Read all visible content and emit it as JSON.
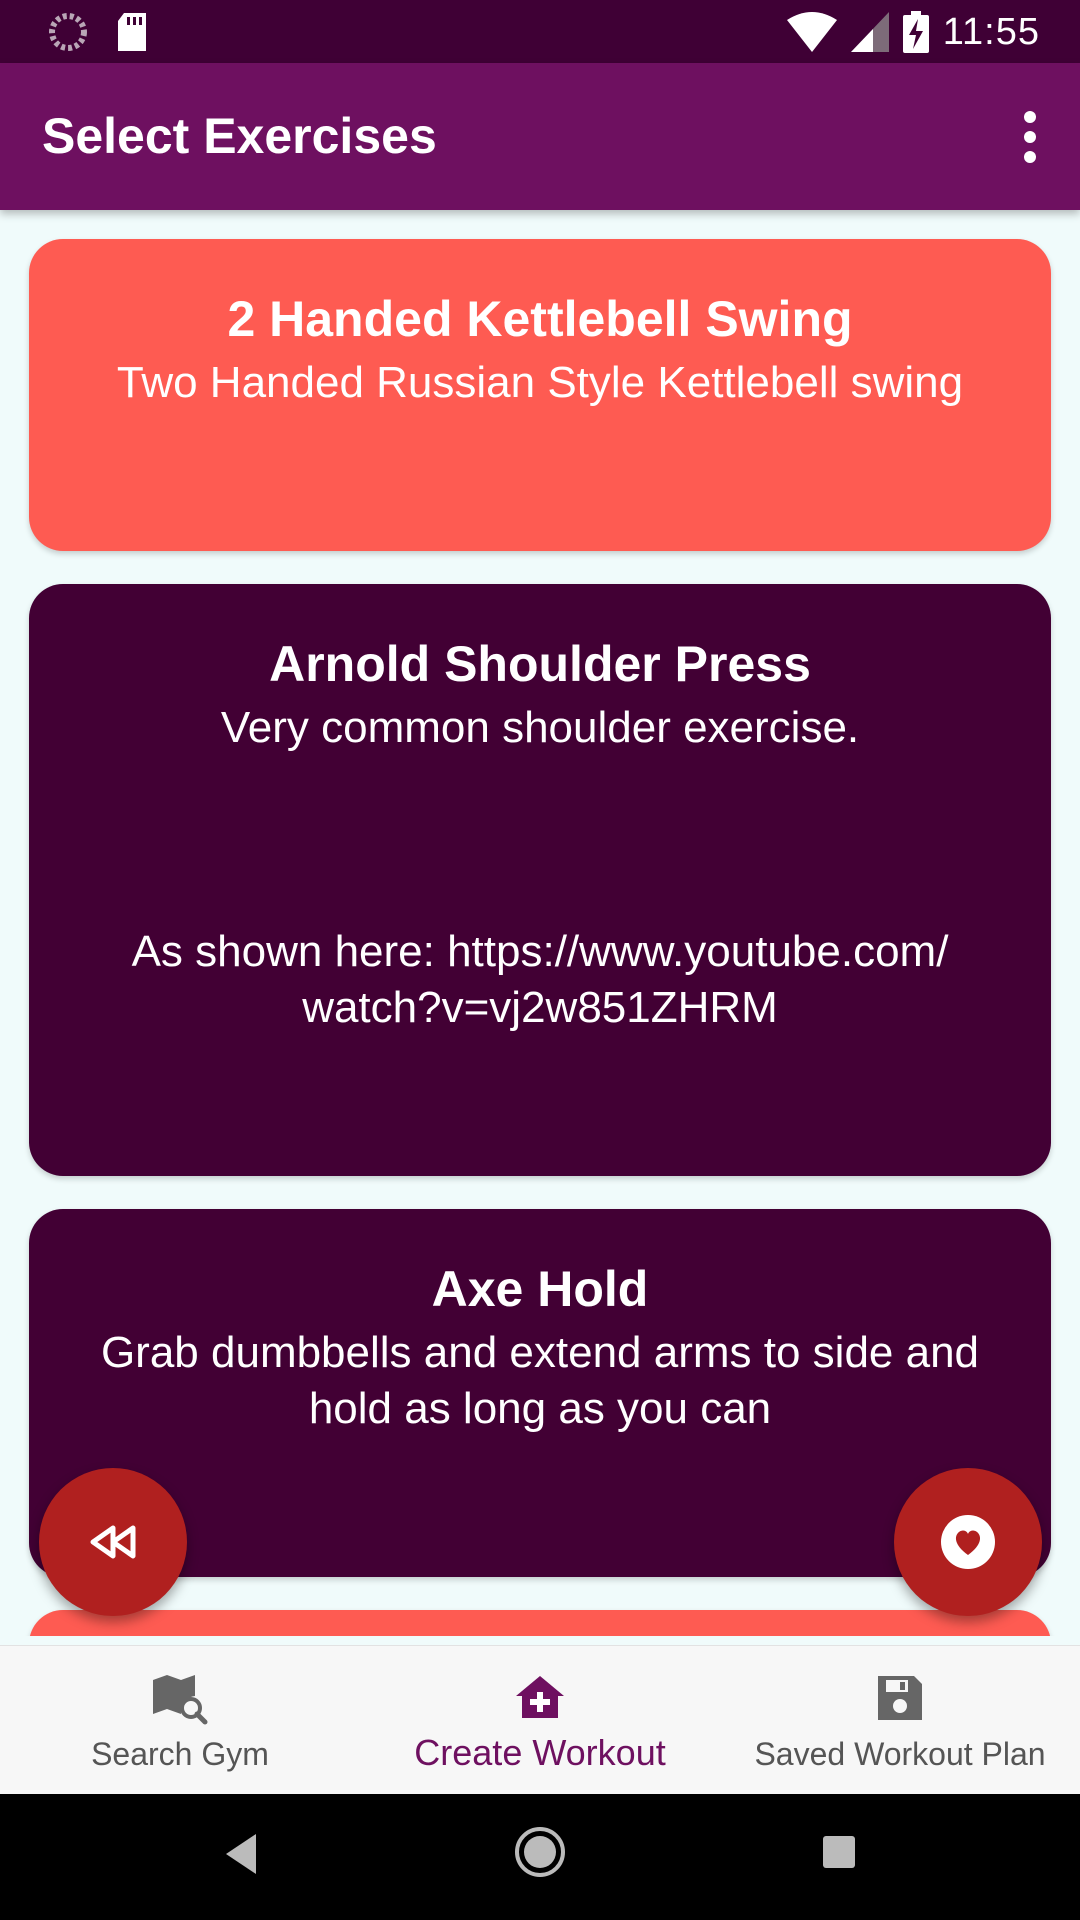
{
  "status_bar": {
    "time": "11:55",
    "icons": [
      "loading-icon",
      "sd-card-icon",
      "wifi-icon",
      "signal-icon",
      "battery-charging-icon"
    ]
  },
  "app_bar": {
    "title": "Select Exercises",
    "overflow_icon": "more-vert-icon"
  },
  "exercises": [
    {
      "name": "2 Handed Kettlebell Swing",
      "description": "Two Handed Russian Style Kettlebell swing",
      "color": "#fe5b52"
    },
    {
      "name": "Arnold Shoulder Press",
      "description": "Very common shoulder exercise.\n\n\n\nAs shown here: https://www.youtube.com/\nwatch?v=vj2w851ZHRM",
      "color": "#420034"
    },
    {
      "name": "Axe Hold",
      "description": "Grab dumbbells and extend arms to side and\nhold as long as you can",
      "color": "#420034"
    }
  ],
  "fabs": {
    "back_icon": "rewind-icon",
    "favorite_icon": "heart-icon"
  },
  "bottom_nav": {
    "items": [
      {
        "label": "Search Gym",
        "icon": "map-search-icon",
        "active": false
      },
      {
        "label": "Create Workout",
        "icon": "home-add-icon",
        "active": true
      },
      {
        "label": "Saved Workout Plan",
        "icon": "save-icon",
        "active": false
      }
    ]
  },
  "colors": {
    "status_bar": "#3f0035",
    "app_bar": "#6e1060",
    "accent_coral": "#fe5b52",
    "card_plum": "#420034",
    "fab": "#b0201f",
    "background": "#f0fbfb"
  }
}
